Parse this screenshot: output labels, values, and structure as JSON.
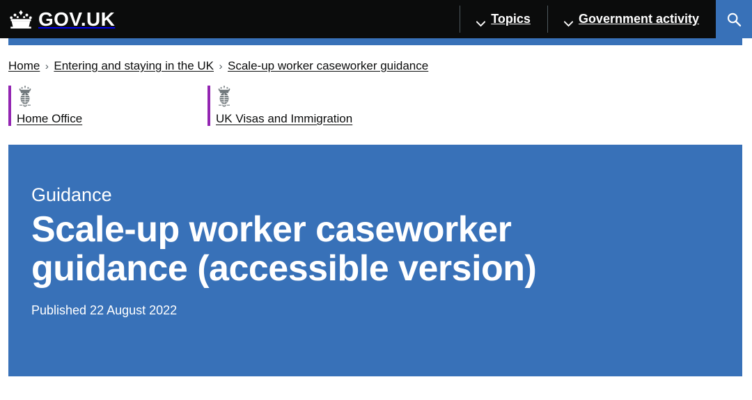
{
  "header": {
    "brand": "GOV.UK",
    "crown_icon": "crown-icon",
    "nav": [
      {
        "label": "Topics",
        "icon": "chevron-down-icon"
      },
      {
        "label": "Government activity",
        "icon": "chevron-down-icon"
      }
    ],
    "search": {
      "icon": "search-icon",
      "label": "Search"
    },
    "accent_color": "#3871b8",
    "background_color": "#0b0c0c"
  },
  "breadcrumbs": {
    "separator": "›",
    "items": [
      {
        "label": "Home"
      },
      {
        "label": "Entering and staying in the UK"
      },
      {
        "label": "Scale-up worker caseworker guidance"
      }
    ]
  },
  "organisations": {
    "accent_color": "#9325b2",
    "items": [
      {
        "name": "Home Office",
        "icon": "royal-crest-icon"
      },
      {
        "name": "UK Visas and Immigration",
        "icon": "royal-crest-icon"
      }
    ]
  },
  "hero": {
    "kicker": "Guidance",
    "title": "Scale-up worker caseworker guidance (accessible version)",
    "published": "Published 22 August 2022",
    "background_color": "#3871b8"
  }
}
